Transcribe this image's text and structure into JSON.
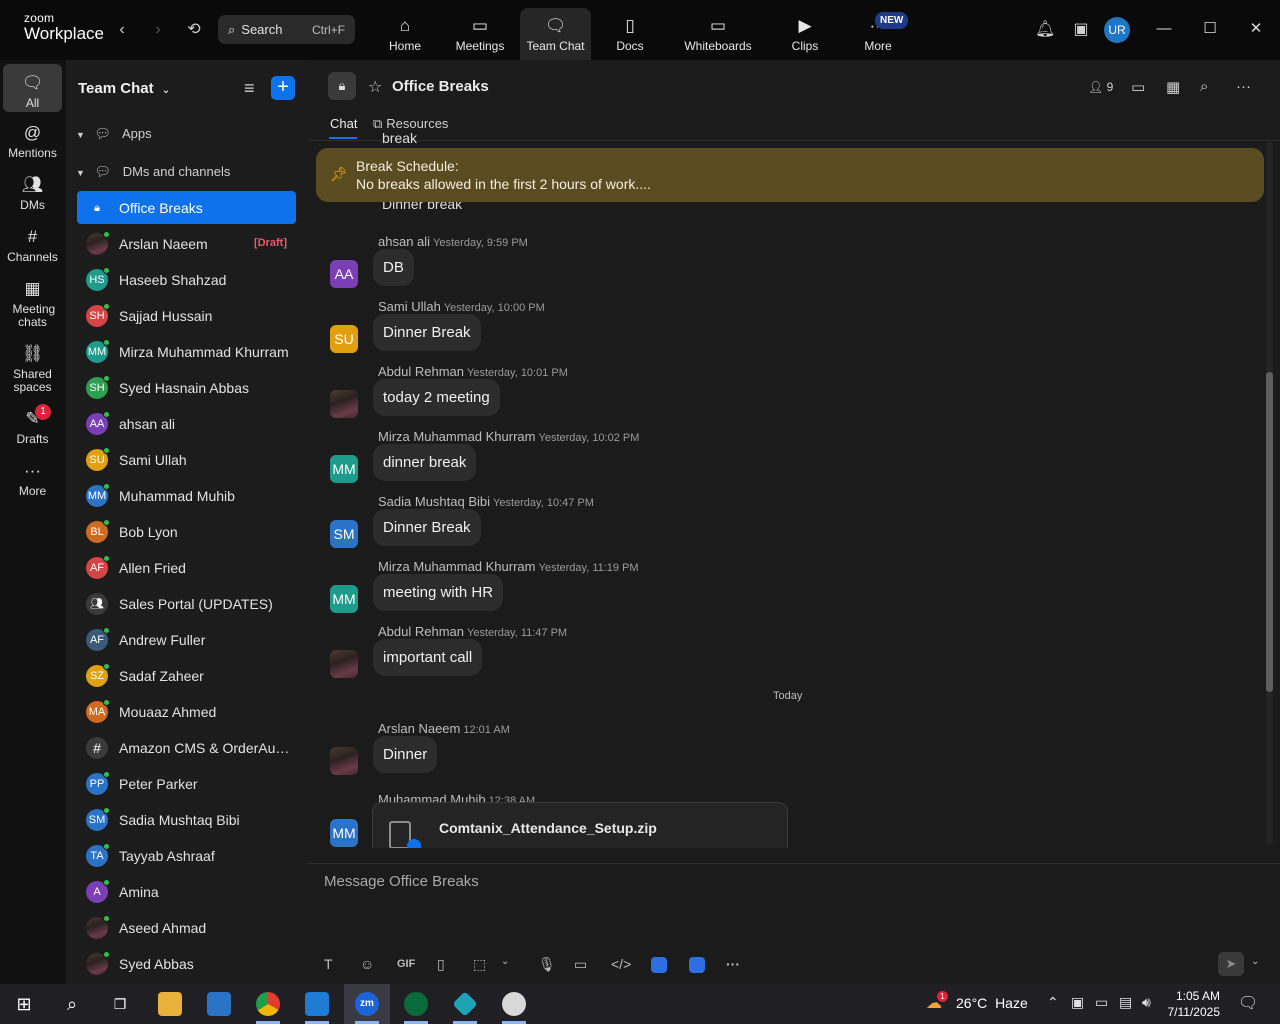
{
  "app": {
    "logo_line1": "zoom",
    "logo_line2": "Workplace",
    "search_placeholder": "Search",
    "search_shortcut": "Ctrl+F",
    "nav_tabs": [
      {
        "label": "Home",
        "icon": "home-icon"
      },
      {
        "label": "Meetings",
        "icon": "video-camera-icon"
      },
      {
        "label": "Team Chat",
        "icon": "chat-bubbles-icon",
        "active": true
      },
      {
        "label": "Docs",
        "icon": "document-icon"
      },
      {
        "label": "Whiteboards",
        "icon": "whiteboard-icon"
      },
      {
        "label": "Clips",
        "icon": "clips-icon"
      },
      {
        "label": "More",
        "icon": "more-dots-icon"
      }
    ],
    "new_badge": "NEW",
    "user_initials": "UR"
  },
  "rail": {
    "items": [
      {
        "label": "All",
        "icon": "chat-icon",
        "active": true
      },
      {
        "label": "Mentions",
        "icon": "at-icon"
      },
      {
        "label": "DMs",
        "icon": "people-icon"
      },
      {
        "label": "Channels",
        "icon": "hash-icon"
      },
      {
        "label": "Meeting chats",
        "icon": "calendar-icon"
      },
      {
        "label": "Shared spaces",
        "icon": "share-icon"
      },
      {
        "label": "Drafts",
        "icon": "drafts-icon",
        "badge": "1"
      },
      {
        "label": "More",
        "icon": "ellipsis-icon"
      }
    ]
  },
  "sidebar": {
    "title": "Team Chat",
    "sections": [
      {
        "label": "Apps"
      },
      {
        "label": "DMs and channels"
      }
    ],
    "channels": [
      {
        "name": "Office Breaks",
        "type": "channel-locked",
        "active": true
      },
      {
        "name": "Arslan Naeem",
        "initials": "",
        "color": "#5a4a3a",
        "draft": "[Draft]"
      },
      {
        "name": "Haseeb Shahzad",
        "initials": "HS",
        "color": "#1f9b8b"
      },
      {
        "name": "Sajjad Hussain",
        "initials": "SH",
        "color": "#d64545"
      },
      {
        "name": "Mirza Muhammad Khurram",
        "initials": "MM",
        "color": "#1f9b8b"
      },
      {
        "name": "Syed Hasnain Abbas",
        "initials": "SH",
        "color": "#2e9e4f"
      },
      {
        "name": "ahsan ali",
        "initials": "AA",
        "color": "#7b3fb5"
      },
      {
        "name": "Sami Ullah",
        "initials": "SU",
        "color": "#e0a010"
      },
      {
        "name": "Muhammad Muhib",
        "initials": "MM",
        "color": "#2a73c7"
      },
      {
        "name": "Bob Lyon",
        "initials": "BL",
        "color": "#d06a1f"
      },
      {
        "name": "Allen Fried",
        "initials": "AF",
        "color": "#d64545"
      },
      {
        "name": "Sales Portal (UPDATES)",
        "type": "group"
      },
      {
        "name": "Andrew Fuller",
        "initials": "AF",
        "color": "#3a5a7a"
      },
      {
        "name": "Sadaf Zaheer",
        "initials": "SZ",
        "color": "#e0a010"
      },
      {
        "name": "Mouaaz Ahmed",
        "initials": "MA",
        "color": "#d06a1f"
      },
      {
        "name": "Amazon CMS & OrderAuto...",
        "type": "hash"
      },
      {
        "name": "Peter Parker",
        "initials": "PP",
        "color": "#2a73c7"
      },
      {
        "name": "Sadia Mushtaq Bibi",
        "initials": "SM",
        "color": "#2a73c7"
      },
      {
        "name": "Tayyab Ashraaf",
        "initials": "TA",
        "color": "#2a73c7"
      },
      {
        "name": "Amina",
        "initials": "A",
        "color": "#7b3fb5"
      },
      {
        "name": "Aseed Ahmad",
        "initials": "",
        "color": "#6b5a4a"
      },
      {
        "name": "Syed Abbas",
        "initials": "",
        "color": "#3a3030"
      }
    ]
  },
  "channel": {
    "name": "Office Breaks",
    "member_count": "9",
    "tabs": [
      "Chat",
      "Resources"
    ],
    "pinned_title": "Break Schedule:",
    "pinned_text": "No breaks allowed in the first 2 hours of work....",
    "cut_top_text": "break",
    "cut_bubble_text": "Dinner break",
    "messages": [
      {
        "author": "ahsan ali",
        "time": "Yesterday, 9:59 PM",
        "text": "DB",
        "initials": "AA",
        "color": "#7b3fb5"
      },
      {
        "author": "Sami Ullah",
        "time": "Yesterday, 10:00 PM",
        "text": "Dinner Break",
        "initials": "SU",
        "color": "#e0a010"
      },
      {
        "author": "Abdul Rehman",
        "time": "Yesterday, 10:01 PM",
        "text": "today 2 meeting",
        "initials": "",
        "color": "photo"
      },
      {
        "author": "Mirza Muhammad Khurram",
        "time": "Yesterday, 10:02 PM",
        "text": "dinner break",
        "initials": "MM",
        "color": "#1f9b8b"
      },
      {
        "author": "Sadia Mushtaq Bibi",
        "time": "Yesterday, 10:47 PM",
        "text": "Dinner Break",
        "initials": "SM",
        "color": "#2a73c7"
      },
      {
        "author": "Mirza Muhammad Khurram",
        "time": "Yesterday, 11:19 PM",
        "text": "meeting with HR",
        "initials": "MM",
        "color": "#1f9b8b"
      },
      {
        "author": "Abdul Rehman",
        "time": "Yesterday, 11:47 PM",
        "text": "important call",
        "initials": "",
        "color": "photo"
      }
    ],
    "today_label": "Today",
    "today_messages": [
      {
        "author": "Arslan Naeem",
        "time": "12:01 AM",
        "text": "Dinner",
        "initials": "",
        "color": "photo"
      }
    ],
    "file_message": {
      "author": "Muhammad Muhib",
      "time": "12:38 AM",
      "initials": "MM",
      "color": "#2a73c7",
      "file_name": "Comtanix_Attendance_Setup.zip"
    },
    "compose_placeholder": "Message Office Breaks",
    "toolbar": {
      "gif": "GIF"
    }
  },
  "taskbar": {
    "weather_temp": "26°C",
    "weather_text": "Haze",
    "weather_badge": "1",
    "time": "1:05 AM",
    "date": "7/11/2025"
  }
}
